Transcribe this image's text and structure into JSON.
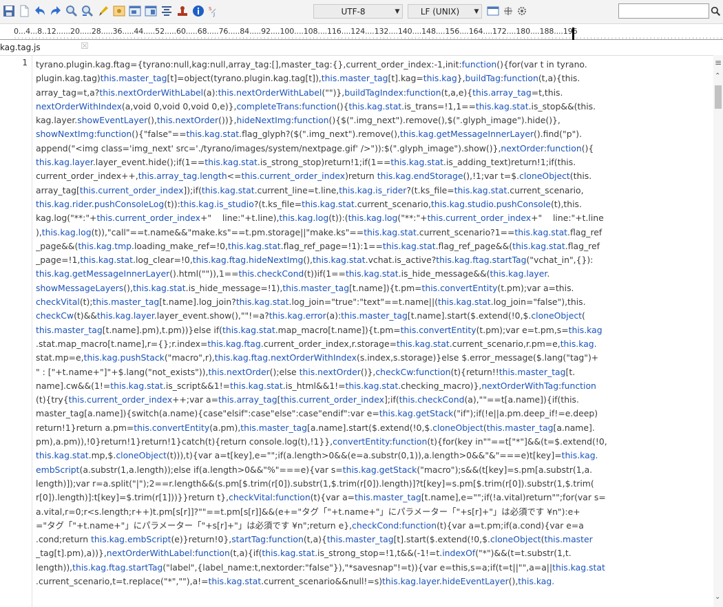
{
  "toolbar": {
    "buttons": [
      {
        "name": "save-icon",
        "color": "#4a6da8"
      },
      {
        "name": "new-document-icon",
        "color": "#8fa0b8"
      },
      {
        "name": "undo-icon",
        "color": "#2e6fcf"
      },
      {
        "name": "redo-icon",
        "color": "#2e6fcf"
      },
      {
        "name": "find-icon",
        "color": "#5b7fb0"
      },
      {
        "name": "find-previous-icon",
        "color": "#5b7fb0"
      },
      {
        "name": "highlight-pen-icon",
        "color": "#e0b100"
      },
      {
        "name": "image-icon",
        "color": "#c98d25"
      },
      {
        "name": "window-icon",
        "color": "#4c78b8"
      },
      {
        "name": "panel-icon",
        "color": "#4c78b8"
      },
      {
        "name": "align-text-icon",
        "color": "#3b5c93"
      },
      {
        "name": "stamp-icon",
        "color": "#b0381f"
      },
      {
        "name": "info-icon",
        "color": "#1d5fc4"
      },
      {
        "name": "charset-icon",
        "color": "#cc3d2e"
      }
    ],
    "encoding": "UTF-8",
    "line_ending": "LF (UNIX)",
    "search_placeholder": ""
  },
  "ruler": {
    "labels": "0...4...8..12......20.....28.....36.....44.....52.....60.....68.....76.....84.....92....100....108....116....124....132....140....148....156....164....172....180....188....196"
  },
  "tab": {
    "filename": "kag.tag.js",
    "close": "☒"
  },
  "editor": {
    "line_number": "1",
    "lines": [
      "tyrano.plugin.kag.ftag={tyrano:null,kag:null,array_tag:[],master_tag:{},current_order_index:-1,init:function(){for(var t in tyrano.",
      "plugin.kag.tag)this.master_tag[t]=object(tyrano.plugin.kag.tag[t]),this.master_tag[t].kag=this.kag},buildTag:function(t,a){this.",
      "array_tag=t,a?this.nextOrderWithLabel(a):this.nextOrderWithLabel(\"\")},buildTagIndex:function(t,a,e){this.array_tag=t,this.",
      "nextOrderWithIndex(a,void 0,void 0,void 0,e)},completeTrans:function(){this.kag.stat.is_trans=!1,1==this.kag.stat.is_stop&&(this.",
      "kag.layer.showEventLayer(),this.nextOrder())},hideNextImg:function(){$(\".img_next\").remove(),$(\".glyph_image\").hide()},",
      "showNextImg:function(){\"false\"==this.kag.stat.flag_glyph?($(\".img_next\").remove(),this.kag.getMessageInnerLayer().find(\"p\").",
      "append(\"<img class='img_next' src='./tyrano/images/system/nextpage.gif' />\")):$(\".glyph_image\").show()},nextOrder:function(){",
      "this.kag.layer.layer_event.hide();if(1==this.kag.stat.is_strong_stop)return!1;if(1==this.kag.stat.is_adding_text)return!1;if(this.",
      "current_order_index++,this.array_tag.length<=this.current_order_index)return this.kag.endStorage(),!1;var t=$.cloneObject(this.",
      "array_tag[this.current_order_index]);if(this.kag.stat.current_line=t.line,this.kag.is_rider?(t.ks_file=this.kag.stat.current_scenario,",
      "this.kag.rider.pushConsoleLog(t)):this.kag.is_studio?(t.ks_file=this.kag.stat.current_scenario,this.kag.studio.pushConsole(t),this.",
      "kag.log(\"**:\"+this.current_order_index+\"    line:\"+t.line),this.kag.log(t)):(this.kag.log(\"**:\"+this.current_order_index+\"    line:\"+t.line",
      "),this.kag.log(t)),\"call\"==t.name&&\"make.ks\"==t.pm.storage||\"make.ks\"==this.kag.stat.current_scenario?1==this.kag.stat.flag_ref",
      "_page&&(this.kag.tmp.loading_make_ref=!0,this.kag.stat.flag_ref_page=!1):1==this.kag.stat.flag_ref_page&&(this.kag.stat.flag_ref",
      "_page=!1,this.kag.stat.log_clear=!0,this.kag.ftag.hideNextImg(),this.kag.stat.vchat.is_active?this.kag.ftag.startTag(\"vchat_in\",{}):",
      "this.kag.getMessageInnerLayer().html(\"\")),1==this.checkCond(t))if(1==this.kag.stat.is_hide_message&&(this.kag.layer.",
      "showMessageLayers(),this.kag.stat.is_hide_message=!1),this.master_tag[t.name]){t.pm=this.convertEntity(t.pm);var a=this.",
      "checkVital(t);this.master_tag[t.name].log_join?this.kag.stat.log_join=\"true\":\"text\"==t.name||(this.kag.stat.log_join=\"false\"),this.",
      "checkCw(t)&&this.kag.layer.layer_event.show(),\"\"!=a?this.kag.error(a):this.master_tag[t.name].start($.extend(!0,$.cloneObject(",
      "this.master_tag[t.name].pm),t.pm))}else if(this.kag.stat.map_macro[t.name]){t.pm=this.convertEntity(t.pm);var e=t.pm,s=this.kag",
      ".stat.map_macro[t.name],r={};r.index=this.kag.ftag.current_order_index,r.storage=this.kag.stat.current_scenario,r.pm=e,this.kag.",
      "stat.mp=e,this.kag.pushStack(\"macro\",r),this.kag.ftag.nextOrderWithIndex(s.index,s.storage)}else $.error_message($.lang(\"tag\")+",
      "\" : [\"+t.name+\"]\"+$.lang(\"not_exists\")),this.nextOrder();else this.nextOrder()},checkCw:function(t){return!!this.master_tag[t.",
      "name].cw&&(1!=this.kag.stat.is_script&&1!=this.kag.stat.is_html&&1!=this.kag.stat.checking_macro)},nextOrderWithTag:function",
      "(t){try{this.current_order_index++;var a=this.array_tag[this.current_order_index];if(this.checkCond(a),\"\"==t[a.name]){if(this.",
      "master_tag[a.name]){switch(a.name){case\"elsif\":case\"else\":case\"endif\":var e=this.kag.getStack(\"if\");if(!e||a.pm.deep_if!=e.deep)",
      "return!1}return a.pm=this.convertEntity(a.pm),this.master_tag[a.name].start($.extend(!0,$.cloneObject(this.master_tag[a.name].",
      "pm),a.pm)),!0}return!1}return!1}catch(t){return console.log(t),!1}},convertEntity:function(t){for(key in\"\"==t[\"*\"]&&(t=$.extend(!0,",
      "this.kag.stat.mp,$.cloneObject(t))),t){var a=t[key],e=\"\";if(a.length>0&&(e=a.substr(0,1)),a.length>0&&\"&\"===e)t[key]=this.kag.",
      "embScript(a.substr(1,a.length));else if(a.length>0&&\"%\"===e){var s=this.kag.getStack(\"macro\");s&&(t[key]=s.pm[a.substr(1,a.",
      "length)]);var r=a.split(\"|\");2==r.length&&(s.pm[$.trim(r[0]).substr(1,$.trim(r[0]).length)]?t[key]=s.pm[$.trim(r[0]).substr(1,$.trim(",
      "r[0]).length)]:t[key]=$.trim(r[1]))}}return t},checkVital:function(t){var a=this.master_tag[t.name],e=\"\";if(!a.vital)return\"\";for(var s=",
      "a.vital,r=0;r<s.length;r++)t.pm[s[r]]?\"\"==t.pm[s[r]]&&(e+=\"タグ「\"+t.name+\"」にパラメーター「\"+s[r]+\"」は必須です ¥n\"):e+",
      "=\"タグ「\"+t.name+\"」にパラメーター「\"+s[r]+\"」は必須です ¥n\";return e},checkCond:function(t){var a=t.pm;if(a.cond){var e=a",
      ".cond;return this.kag.embScript(e)}return!0},startTag:function(t,a){this.master_tag[t].start($.extend(!0,$.cloneObject(this.master",
      "_tag[t].pm),a))},nextOrderWithLabel:function(t,a){if(this.kag.stat.is_strong_stop=!1,t&&(-1!=t.indexOf(\"*\")&&(t=t.substr(1,t.",
      "length)),this.kag.ftag.startTag(\"label\",{label_name:t,nextorder:\"false\"}),\"*savesnap\"!=t)){var e=this,s=a;if(t=t||\"\",a=a||this.kag.stat",
      ".current_scenario,t=t.replace(\"*\",\"\"),a!=this.kag.stat.current_scenario&&null!=s)this.kag.layer.hideEventLayer(),this.kag."
    ]
  }
}
